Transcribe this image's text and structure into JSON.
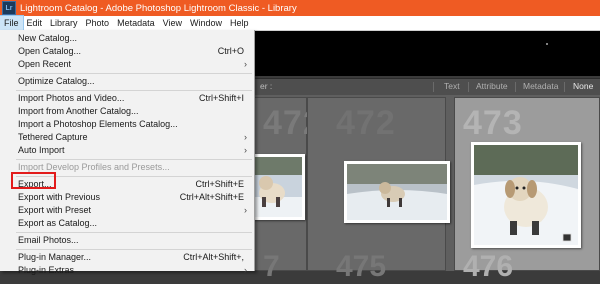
{
  "titlebar": {
    "app_icon_text": "Lr",
    "title": "Lightroom Catalog - Adobe Photoshop Lightroom Classic - Library"
  },
  "menubar": {
    "items": [
      "File",
      "Edit",
      "Library",
      "Photo",
      "Metadata",
      "View",
      "Window",
      "Help"
    ]
  },
  "filterbar": {
    "label": "er :",
    "tabs": [
      "Text",
      "Attribute",
      "Metadata",
      "None"
    ]
  },
  "grid": {
    "cells": [
      {
        "number": "472",
        "number_below": "7"
      },
      {
        "number": "472",
        "number_below": "475"
      },
      {
        "number": "473",
        "number_below": "476"
      }
    ]
  },
  "file_menu": {
    "items": [
      {
        "label": "New Catalog...",
        "shortcut": "",
        "submenu": false,
        "disabled": false
      },
      {
        "label": "Open Catalog...",
        "shortcut": "Ctrl+O",
        "submenu": false,
        "disabled": false
      },
      {
        "label": "Open Recent",
        "shortcut": "",
        "submenu": true,
        "disabled": false
      },
      {
        "label": "Optimize Catalog...",
        "shortcut": "",
        "submenu": false,
        "disabled": false
      },
      {
        "label": "Import Photos and Video...",
        "shortcut": "Ctrl+Shift+I",
        "submenu": false,
        "disabled": false
      },
      {
        "label": "Import from Another Catalog...",
        "shortcut": "",
        "submenu": false,
        "disabled": false
      },
      {
        "label": "Import a Photoshop Elements Catalog...",
        "shortcut": "",
        "submenu": false,
        "disabled": false
      },
      {
        "label": "Tethered Capture",
        "shortcut": "",
        "submenu": true,
        "disabled": false
      },
      {
        "label": "Auto Import",
        "shortcut": "",
        "submenu": true,
        "disabled": false
      },
      {
        "label": "Import Develop Profiles and Presets...",
        "shortcut": "",
        "submenu": false,
        "disabled": true
      },
      {
        "label": "Export...",
        "shortcut": "Ctrl+Shift+E",
        "submenu": false,
        "disabled": false
      },
      {
        "label": "Export with Previous",
        "shortcut": "Ctrl+Alt+Shift+E",
        "submenu": false,
        "disabled": false
      },
      {
        "label": "Export with Preset",
        "shortcut": "",
        "submenu": true,
        "disabled": false
      },
      {
        "label": "Export as Catalog...",
        "shortcut": "",
        "submenu": false,
        "disabled": false
      },
      {
        "label": "Email Photos...",
        "shortcut": "",
        "submenu": false,
        "disabled": false
      },
      {
        "label": "Plug-in Manager...",
        "shortcut": "Ctrl+Alt+Shift+,",
        "submenu": false,
        "disabled": false
      },
      {
        "label": "Plug-in Extras",
        "shortcut": "",
        "submenu": true,
        "disabled": false
      }
    ]
  }
}
